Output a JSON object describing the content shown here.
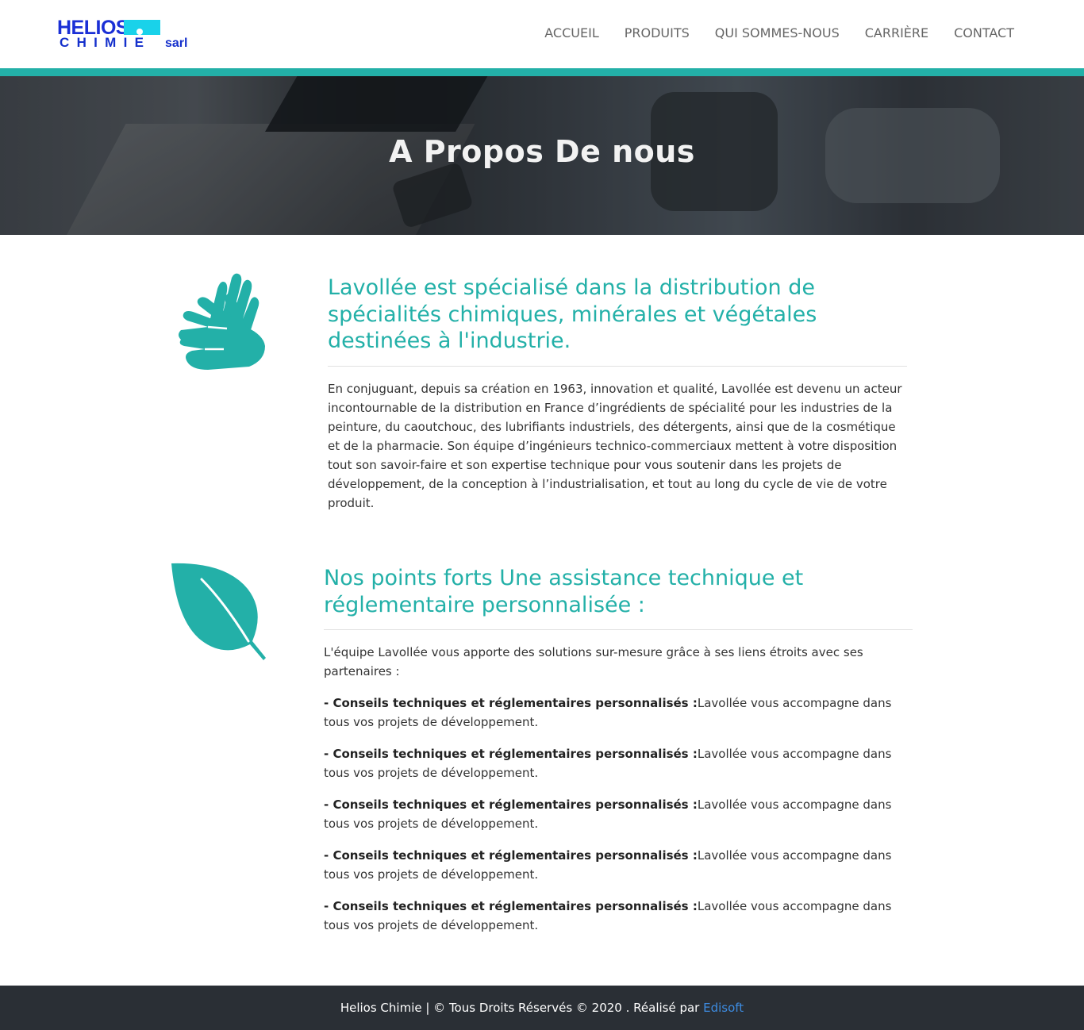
{
  "brand": {
    "logo_line1": "HELIOS",
    "logo_line2": "CHIMIE",
    "logo_suffix": "sarl"
  },
  "nav": {
    "items": [
      {
        "label": "ACCUEIL"
      },
      {
        "label": "PRODUITS"
      },
      {
        "label": "QUI SOMMES-NOUS"
      },
      {
        "label": "CARRIÈRE"
      },
      {
        "label": "CONTACT"
      }
    ]
  },
  "hero": {
    "title": "A Propos De nous"
  },
  "section1": {
    "icon": "hands-icon",
    "title": "Lavollée est spécialisé dans la distribution de spécialités chimiques, minérales et végétales destinées à l'industrie.",
    "body": "En conjuguant, depuis sa création en 1963, innovation et qualité, Lavollée est devenu un acteur incontournable de la distribution en France d’ingrédients de spécialité pour les industries de la peinture, du caoutchouc, des lubrifiants industriels, des détergents, ainsi que de la cosmétique et de la pharmacie. Son équipe d’ingénieurs technico-commerciaux mettent à votre disposition tout son savoir-faire et son expertise technique pour vous soutenir dans les projets de développement, de la conception à l’industrialisation, et tout au long du cycle de vie de votre produit."
  },
  "section2": {
    "icon": "leaf-icon",
    "title": "Nos points forts Une assistance technique et réglementaire personnalisée :",
    "intro": "L'équipe Lavollée vous apporte des solutions sur-mesure grâce à ses liens étroits avec ses partenaires :",
    "points": [
      {
        "strong": "- Conseils techniques et réglementaires personnalisés :",
        "text": "Lavollée vous accompagne dans tous vos projets de développement."
      },
      {
        "strong": "- Conseils techniques et réglementaires personnalisés :",
        "text": "Lavollée vous accompagne dans tous vos projets de développement."
      },
      {
        "strong": "- Conseils techniques et réglementaires personnalisés :",
        "text": "Lavollée vous accompagne dans tous vos projets de développement."
      },
      {
        "strong": "- Conseils techniques et réglementaires personnalisés :",
        "text": "Lavollée vous accompagne dans tous vos projets de développement."
      },
      {
        "strong": "- Conseils techniques et réglementaires personnalisés :",
        "text": "Lavollée vous accompagne dans tous vos projets de développement."
      }
    ]
  },
  "footer": {
    "text": "Helios Chimie | © Tous Droits Réservés © 2020 . Réalisé par ",
    "link_label": "Edisoft"
  },
  "colors": {
    "accent": "#23b0a8",
    "footer_bg": "#2a2f35",
    "link": "#3d8be0",
    "logo_blue": "#1a2fd6",
    "logo_cyan": "#19d2ea"
  }
}
